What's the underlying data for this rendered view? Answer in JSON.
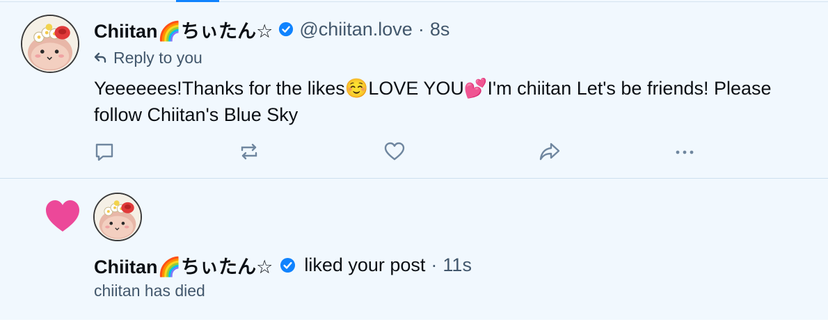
{
  "colors": {
    "accent": "#1083fe",
    "unread_background": "#f1f8fe",
    "like_heart": "#ec4899",
    "muted_text": "#42576c",
    "primary_text": "#0b0f14"
  },
  "reply_post": {
    "author": {
      "display_name": "Chiitan🌈ちぃたん☆",
      "handle": "@chiitan.love",
      "verified": true
    },
    "separator": "·",
    "timestamp": "8s",
    "reply_indicator": "Reply to you",
    "text": "Yeeeeees!Thanks for the likes☺️LOVE YOU💕I'm chiitan Let's be friends! Please follow Chiitan's Blue Sky",
    "actions": [
      "reply-icon",
      "repost-icon",
      "like-icon",
      "share-icon",
      "more-icon"
    ]
  },
  "like_notification": {
    "icon": "heart-icon",
    "display_name": "Chiitan🌈ちぃたん☆",
    "verified": true,
    "action_text": "liked your post",
    "separator": "·",
    "timestamp": "11s",
    "post_preview": "chiitan has died"
  }
}
